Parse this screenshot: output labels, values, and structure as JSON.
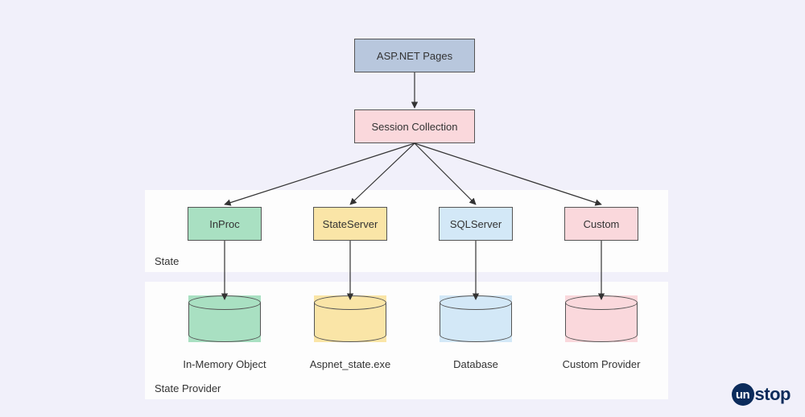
{
  "top_box": "ASP.NET Pages",
  "session_box": "Session Collection",
  "state_panel_label": "State",
  "provider_panel_label": "State Provider",
  "modes": {
    "inproc": "InProc",
    "stateserver": "StateServer",
    "sqlserver": "SQLServer",
    "custom": "Custom"
  },
  "providers": {
    "inproc": "In-Memory Object",
    "stateserver": "Aspnet_state.exe",
    "sqlserver": "Database",
    "custom": "Custom Provider"
  },
  "logo": {
    "prefix": "un",
    "suffix": "stop"
  }
}
